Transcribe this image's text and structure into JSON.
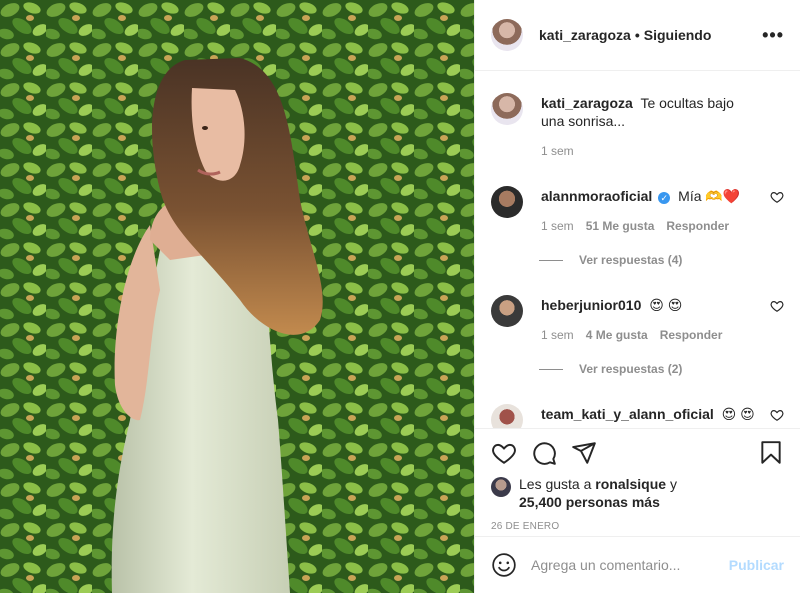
{
  "header": {
    "username": "kati_zaragoza",
    "separator": "•",
    "follow_status": "Siguiendo",
    "more": "•••"
  },
  "comments": [
    {
      "username": "kati_zaragoza",
      "text": "Te ocultas bajo una sonrisa...",
      "time": "1 sem"
    },
    {
      "username": "alannmoraoficial",
      "verified": true,
      "text": "Mía 🫶❤️",
      "time": "1 sem",
      "likes": "51 Me gusta",
      "reply": "Responder",
      "view_replies": "Ver respuestas (4)"
    },
    {
      "username": "heberjunior010",
      "text": "😍 😍",
      "time": "1 sem",
      "likes": "4 Me gusta",
      "reply": "Responder",
      "view_replies": "Ver respuestas (2)"
    },
    {
      "username": "team_kati_y_alann_oficial",
      "text": "😍 😍"
    }
  ],
  "likes": {
    "prefix": "Les gusta a",
    "user": "ronalsique",
    "conj": "y",
    "others": "25,400 personas más"
  },
  "date": "26 DE ENERO",
  "add_comment": {
    "placeholder": "Agrega un comentario...",
    "publish": "Publicar"
  },
  "colors": {
    "accent": "#0095f6",
    "publish_disabled": "#b3dbff",
    "muted": "#8e8e8e",
    "border": "#efefef"
  }
}
